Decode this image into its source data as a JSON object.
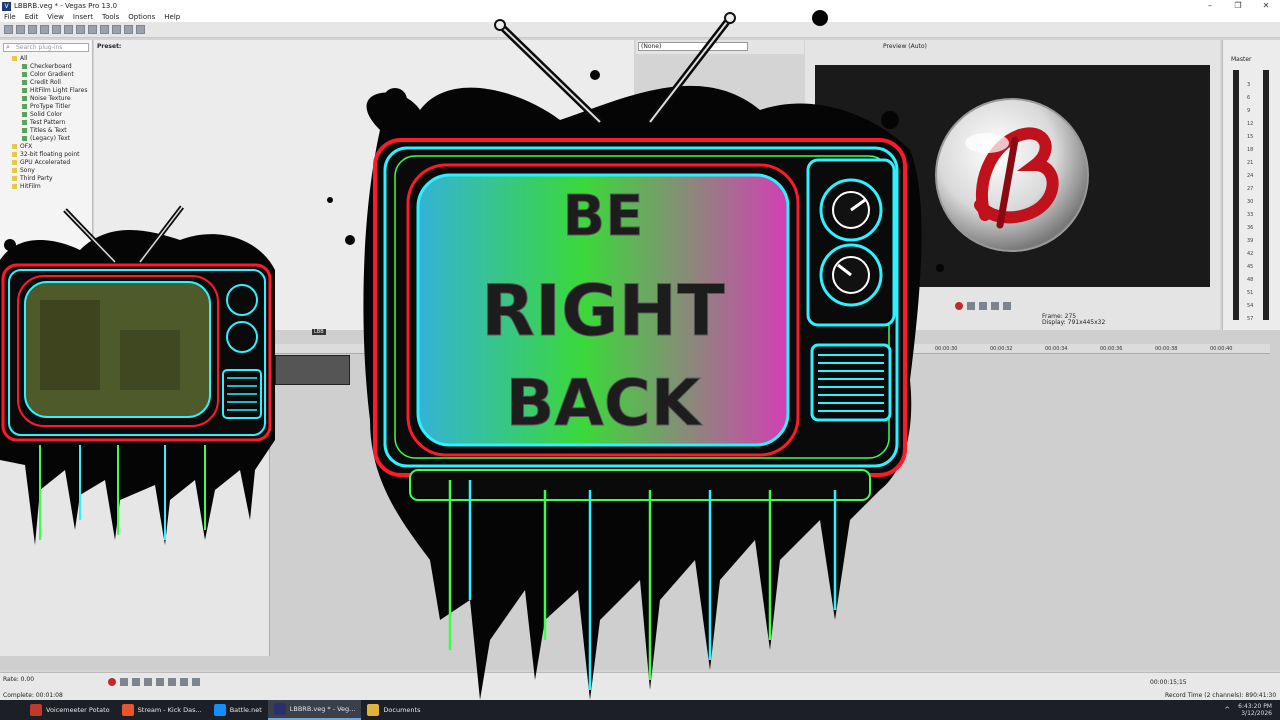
{
  "window": {
    "title": "LBBRB.veg * - Vegas Pro 13.0",
    "controls": [
      "–",
      "❐",
      "✕"
    ]
  },
  "menu": [
    "File",
    "Edit",
    "View",
    "Insert",
    "Tools",
    "Options",
    "Help"
  ],
  "plugins": {
    "search_placeholder": "Search plug-ins",
    "preset_label": "Preset:",
    "tree": [
      {
        "label": "All",
        "type": "folder",
        "indent": 0
      },
      {
        "label": "Checkerboard",
        "type": "leaf",
        "indent": 1
      },
      {
        "label": "Color Gradient",
        "type": "leaf",
        "indent": 1
      },
      {
        "label": "Credit Roll",
        "type": "leaf",
        "indent": 1
      },
      {
        "label": "HitFilm Light Flares",
        "type": "leaf",
        "indent": 1
      },
      {
        "label": "Noise Texture",
        "type": "leaf",
        "indent": 1
      },
      {
        "label": "ProType Titler",
        "type": "leaf",
        "indent": 1
      },
      {
        "label": "Solid Color",
        "type": "leaf",
        "indent": 1
      },
      {
        "label": "Test Pattern",
        "type": "leaf",
        "indent": 1
      },
      {
        "label": "Titles & Text",
        "type": "leaf",
        "indent": 1
      },
      {
        "label": "(Legacy) Text",
        "type": "leaf",
        "indent": 1
      },
      {
        "label": "OFX",
        "type": "folder",
        "indent": 0
      },
      {
        "label": "32-bit floating point",
        "type": "folder",
        "indent": 0
      },
      {
        "label": "GPU Accelerated",
        "type": "folder",
        "indent": 0
      },
      {
        "label": "Sony",
        "type": "folder",
        "indent": 0
      },
      {
        "label": "Third Party",
        "type": "folder",
        "indent": 0
      },
      {
        "label": "HitFilm",
        "type": "folder",
        "indent": 0
      }
    ]
  },
  "trimmer": {
    "selection": "(None)"
  },
  "preview": {
    "quality": "Preview (Auto)",
    "frame_label": "Frame:",
    "frame_value": "275",
    "display_label": "Display:",
    "display_value": "791x445x32"
  },
  "master": {
    "label": "Master",
    "db_ticks": [
      "3",
      "6",
      "9",
      "12",
      "15",
      "18",
      "21",
      "24",
      "27",
      "30",
      "33",
      "36",
      "39",
      "42",
      "45",
      "48",
      "51",
      "54",
      "57"
    ]
  },
  "timeline": {
    "ruler_ticks": [
      "00:00:30",
      "00:00:32",
      "00:00:34",
      "00:00:36",
      "00:00:38",
      "00:00:40"
    ],
    "clip_label": "LBB"
  },
  "transport": {
    "rate": "Rate: 0.00",
    "complete": "Complete: 00:01:08",
    "timecode": "00:00:15;15",
    "record_time": "Record Time (2 channels): 890:41:30"
  },
  "taskbar": {
    "items": [
      {
        "label": "Voicemeeter Potato",
        "icon": "voicemeeter-icon",
        "color": "#c0392b",
        "active": false
      },
      {
        "label": "Stream - Kick Das...",
        "icon": "brave-icon",
        "color": "#e8542b",
        "active": false
      },
      {
        "label": "Battle.net",
        "icon": "battlenet-icon",
        "color": "#148eff",
        "active": false
      },
      {
        "label": "LBBRB.veg * - Veg...",
        "icon": "vegas-icon",
        "color": "#2b2f6b",
        "active": true
      },
      {
        "label": "Documents",
        "icon": "folder-icon",
        "color": "#e0b43c",
        "active": false
      }
    ],
    "time": "6:43:20 PM",
    "date": "3/12/2026"
  },
  "overlay": {
    "sign_lines": [
      "BE",
      "RIGHT",
      "BACK"
    ]
  },
  "colors": {
    "neon_cyan": "#2ef2ff",
    "neon_green": "#3cff4a",
    "neon_red": "#ff1a2a",
    "neon_magenta": "#ff2bd6",
    "ink": "#050505"
  }
}
